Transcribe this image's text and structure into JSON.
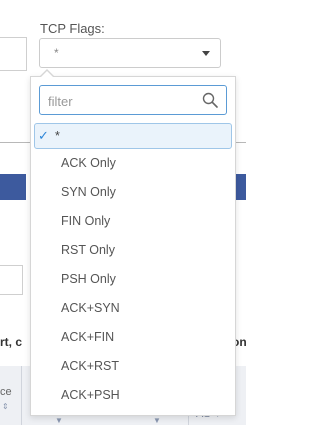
{
  "tcp_flags": {
    "label": "TCP Flags:",
    "selected_value": "*",
    "filter_placeholder": "filter",
    "options": [
      {
        "label": "*",
        "selected": true
      },
      {
        "label": "ACK Only"
      },
      {
        "label": "SYN Only"
      },
      {
        "label": "FIN Only"
      },
      {
        "label": "RST Only"
      },
      {
        "label": "PSH Only"
      },
      {
        "label": "ACK+SYN"
      },
      {
        "label": "ACK+FIN"
      },
      {
        "label": "ACK+RST"
      },
      {
        "label": "ACK+PSH"
      }
    ]
  },
  "background": {
    "left_text": "rt, c",
    "right_text": "on",
    "col_left": "ce",
    "col_right": "AS"
  },
  "colors": {
    "accent": "#2e86d8",
    "bar": "#3d5a9e",
    "selected_bg": "#eaf3fb"
  }
}
